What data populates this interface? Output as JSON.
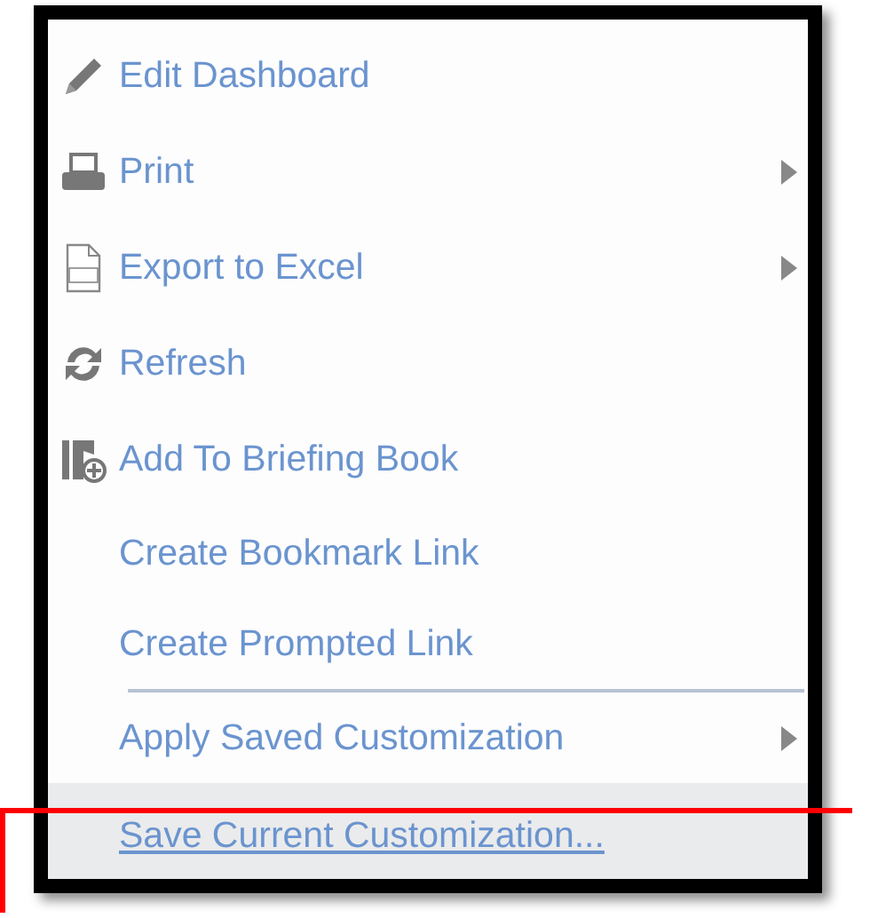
{
  "menu": {
    "items": [
      {
        "label": "Edit Dashboard",
        "kind": "pencil",
        "submenu": false,
        "hovered": false
      },
      {
        "label": "Print",
        "kind": "printer",
        "submenu": true,
        "hovered": false
      },
      {
        "label": "Export to Excel",
        "kind": "excel",
        "submenu": true,
        "hovered": false
      },
      {
        "label": "Refresh",
        "kind": "refresh",
        "submenu": false,
        "hovered": false
      },
      {
        "label": "Add To Briefing Book",
        "kind": "book",
        "submenu": false,
        "hovered": false
      },
      {
        "label": "Create Bookmark Link",
        "kind": "plain",
        "submenu": false,
        "hovered": false
      },
      {
        "label": "Create Prompted Link",
        "kind": "plain",
        "submenu": false,
        "hovered": false,
        "separator_after": true
      },
      {
        "label": "Apply Saved Customization",
        "kind": "plain",
        "submenu": true,
        "hovered": false
      },
      {
        "label": "Save Current Customization...",
        "kind": "plain",
        "submenu": false,
        "hovered": true
      }
    ]
  },
  "highlight_box": true
}
